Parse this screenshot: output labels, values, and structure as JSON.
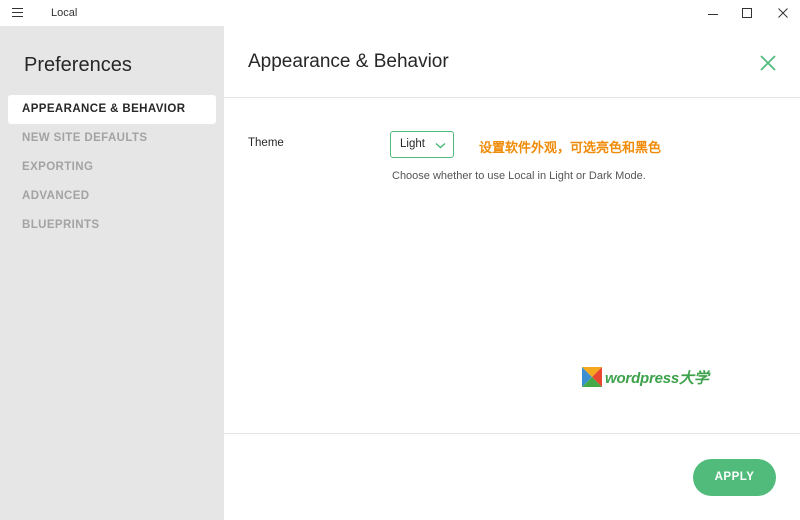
{
  "window": {
    "app_title": "Local"
  },
  "sidebar": {
    "title": "Preferences",
    "items": [
      {
        "label": "APPEARANCE & BEHAVIOR",
        "active": true
      },
      {
        "label": "NEW SITE DEFAULTS",
        "active": false
      },
      {
        "label": "EXPORTING",
        "active": false
      },
      {
        "label": "ADVANCED",
        "active": false
      },
      {
        "label": "BLUEPRINTS",
        "active": false
      }
    ]
  },
  "main": {
    "title": "Appearance & Behavior",
    "theme": {
      "label": "Theme",
      "selected": "Light",
      "help": "Choose whether to use Local in Light or Dark Mode.",
      "annotation": "设置软件外观，可选亮色和黑色"
    },
    "apply_label": "APPLY"
  },
  "watermark": {
    "text": "wordpress大学"
  },
  "colors": {
    "accent": "#51bb7b",
    "annotation": "#f08c0a",
    "sidebar_bg": "#e6e6e6"
  }
}
